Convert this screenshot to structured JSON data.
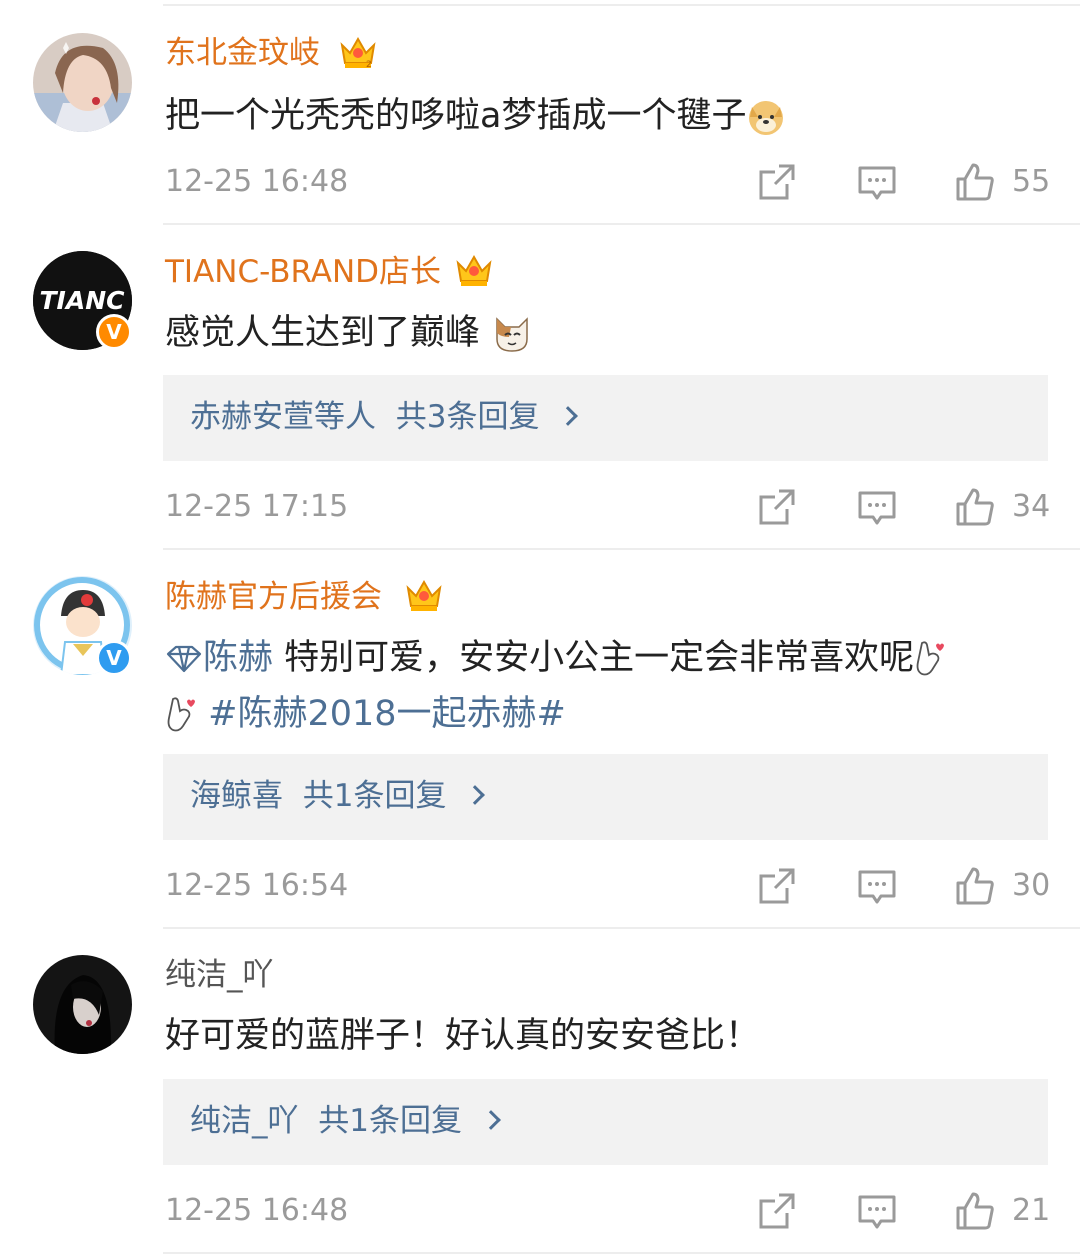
{
  "comments": [
    {
      "username": "东北金玟岐",
      "text": "把一个光秃秃的哆啦a梦插成一个毽子",
      "time": "12-25 16:48",
      "likes": "55"
    },
    {
      "username": "TIANC-BRAND店长",
      "avatar_text": "TIANC",
      "text": "感觉人生达到了巅峰",
      "reply_users": "赤赫安萱等人",
      "reply_count": "共3条回复",
      "time": "12-25 17:15",
      "likes": "34"
    },
    {
      "username": "陈赫官方后援会",
      "mention": "陈赫",
      "text": " 特别可爱，安安小公主一定会非常喜欢呢",
      "hashtag": "#陈赫2018一起赤赫#",
      "reply_users": "海鲸喜",
      "reply_count": "共1条回复",
      "time": "12-25 16:54",
      "likes": "30"
    },
    {
      "username": "纯洁_吖",
      "text": "好可爱的蓝胖子！好认真的安安爸比！",
      "reply_users": "纯洁_吖",
      "reply_count": "共1条回复",
      "time": "12-25 16:48",
      "likes": "21"
    }
  ],
  "verified_badge": "V",
  "colors": {
    "username": "#e0731c",
    "link": "#4d6f94",
    "meta": "#9a9a9a",
    "reply_bg": "#f2f2f2"
  },
  "icons": [
    "crown-icon",
    "share-icon",
    "comment-icon",
    "like-icon",
    "verified-icon",
    "emoji-icon"
  ]
}
